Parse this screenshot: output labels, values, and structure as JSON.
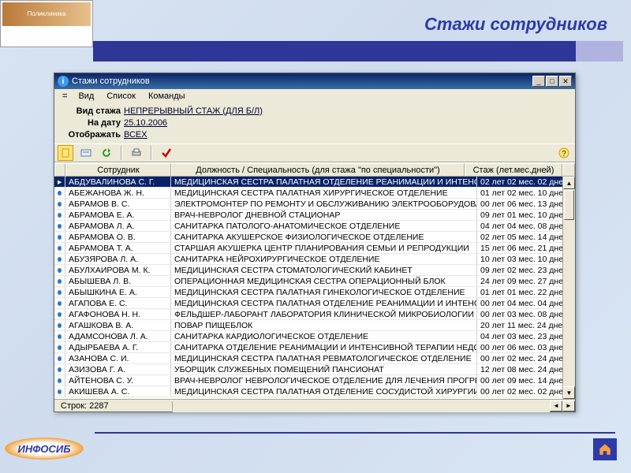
{
  "page": {
    "title": "Стажи сотрудников",
    "logo_brand": "Поликлиника",
    "footer_brand": "ИНФОСИБ"
  },
  "window": {
    "title": "Стажи сотрудников",
    "menu": {
      "dash": "=",
      "view": "Вид",
      "list": "Список",
      "commands": "Команды"
    },
    "filters": {
      "kind_label": "Вид стажа",
      "kind_value": "НЕПРЕРЫВНЫЙ СТАЖ (ДЛЯ Б/Л)",
      "date_label": "На дату",
      "date_value": "25.10.2006",
      "show_label": "Отображать",
      "show_value": "ВСЕХ"
    },
    "columns": {
      "dot": "",
      "employee": "Сотрудник",
      "position": "Должность / Специальность (для стажа \"по специальности\")",
      "experience": "Стаж (лет.мес.дней)"
    },
    "status": {
      "prefix": "Строк:",
      "count": "2287"
    },
    "rows": [
      {
        "emp": "АБДУВАЛИНОВА С. Г.",
        "pos": "МЕДИЦИНСКАЯ СЕСТРА ПАЛАТНАЯ ОТДЕЛЕНИЕ РЕАНИМАЦИИ И ИНТЕНСИВНОЙ ТЕР",
        "exp": "02 лет 02 мес. 02 дней",
        "sel": true
      },
      {
        "emp": "АБЕЖАНОВА Ж. Н.",
        "pos": "МЕДИЦИНСКАЯ СЕСТРА ПАЛАТНАЯ ХИРУРГИЧЕСКОЕ ОТДЕЛЕНИЕ",
        "exp": "01 лет 02 мес. 10 дней"
      },
      {
        "emp": "АБРАМОВ В. С.",
        "pos": "ЭЛЕКТРОМОНТЕР ПО РЕМОНТУ И ОБСЛУЖИВАНИЮ ЭЛЕКТРООБОРУДОВАНИЯ V РАЗ",
        "exp": "00 лет 06 мес. 13 дней"
      },
      {
        "emp": "АБРАМОВА Е. А.",
        "pos": "ВРАЧ-НЕВРОЛОГ ДНЕВНОЙ СТАЦИОНАР",
        "exp": "09 лет 01 мес. 10 дней"
      },
      {
        "emp": "АБРАМОВА Л. А.",
        "pos": "САНИТАРКА ПАТОЛОГО-АНАТОМИЧЕСКОЕ ОТДЕЛЕНИЕ",
        "exp": "04 лет 04 мес. 08 дней"
      },
      {
        "emp": "АБРАМОВА О. В.",
        "pos": "САНИТАРКА АКУШЕРСКОЕ ФИЗИОЛОГИЧЕСКОЕ ОТДЕЛЕНИЕ",
        "exp": "02 лет 05 мес. 14 дней"
      },
      {
        "emp": "АБРАМОВА Т. А.",
        "pos": "СТАРШАЯ АКУШЕРКА ЦЕНТР ПЛАНИРОВАНИЯ СЕМЬИ И РЕПРОДУКЦИИ",
        "exp": "15 лет 06 мес. 21 дней"
      },
      {
        "emp": "АБУЗЯРОВА Л. А.",
        "pos": "САНИТАРКА НЕЙРОХИРУРГИЧЕСКОЕ ОТДЕЛЕНИЕ",
        "exp": "10 лет 03 мес. 10 дней"
      },
      {
        "emp": "АБУЛХАИРОВА М. К.",
        "pos": "МЕДИЦИНСКАЯ СЕСТРА СТОМАТОЛОГИЧЕСКИЙ КАБИНЕТ",
        "exp": "09 лет 02 мес. 23 дней"
      },
      {
        "emp": "АБЫШЕВА Л. В.",
        "pos": "ОПЕРАЦИОННАЯ МЕДИЦИНСКАЯ СЕСТРА ОПЕРАЦИОННЫЙ БЛОК",
        "exp": "24 лет 09 мес. 27 дней"
      },
      {
        "emp": "АБЫШКИНА Е. А.",
        "pos": "МЕДИЦИНСКАЯ СЕСТРА ПАЛАТНАЯ ГИНЕКОЛОГИЧЕСКОЕ ОТДЕЛЕНИЕ",
        "exp": "01 лет 01 мес. 22 дней"
      },
      {
        "emp": "АГАПОВА Е. С.",
        "pos": "МЕДИЦИНСКАЯ СЕСТРА ПАЛАТНАЯ ОТДЕЛЕНИЕ РЕАНИМАЦИИ И ИНТЕНСИВНОЙ ТЕР",
        "exp": "00 лет 04 мес. 04 дней"
      },
      {
        "emp": "АГАФОНОВА Н. Н.",
        "pos": "ФЕЛЬДШЕР-ЛАБОРАНТ ЛАБОРАТОРИЯ КЛИНИЧЕСКОЙ МИКРОБИОЛОГИИ (БАКТЕРИО",
        "exp": "00 лет 03 мес. 08 дней"
      },
      {
        "emp": "АГАШКОВА В. А.",
        "pos": "ПОВАР ПИЩЕБЛОК",
        "exp": "20 лет 11 мес. 24 дней"
      },
      {
        "emp": "АДАМСОНОВА Л. А.",
        "pos": "САНИТАРКА КАРДИОЛОГИЧЕСКОЕ ОТДЕЛЕНИЕ",
        "exp": "04 лет 03 мес. 23 дней"
      },
      {
        "emp": "АДЫРБАЕВА А. Г.",
        "pos": "САНИТАРКА ОТДЕЛЕНИЕ РЕАНИМАЦИИ И ИНТЕНСИВНОЙ ТЕРАПИИ НЕДОНОШЕННЫХ",
        "exp": "00 лет 06 мес. 03 дней"
      },
      {
        "emp": "АЗАНОВА С. И.",
        "pos": "МЕДИЦИНСКАЯ СЕСТРА ПАЛАТНАЯ РЕВМАТОЛОГИЧЕСКОЕ ОТДЕЛЕНИЕ",
        "exp": "00 лет 02 мес. 24 дней"
      },
      {
        "emp": "АЗИЗОВА Г. А.",
        "pos": "УБОРЩИК СЛУЖЕБНЫХ ПОМЕЩЕНИЙ ПАНСИОНАТ",
        "exp": "12 лет 08 мес. 24 дней"
      },
      {
        "emp": "АЙТЕНОВА С. У.",
        "pos": "ВРАЧ-НЕВРОЛОГ НЕВРОЛОГИЧЕСКОЕ ОТДЕЛЕНИЕ ДЛЯ ЛЕЧЕНИЯ ПРОГРЕССИРУЮЩ",
        "exp": "00 лет 09 мес. 14 дней"
      },
      {
        "emp": "АКИШЕВА А. С.",
        "pos": "МЕДИЦИНСКАЯ СЕСТРА ПАЛАТНАЯ ОТДЕЛЕНИЕ СОСУДИСТОЙ ХИРУРГИИ",
        "exp": "00 лет 02 мес. 02 дней"
      }
    ]
  }
}
